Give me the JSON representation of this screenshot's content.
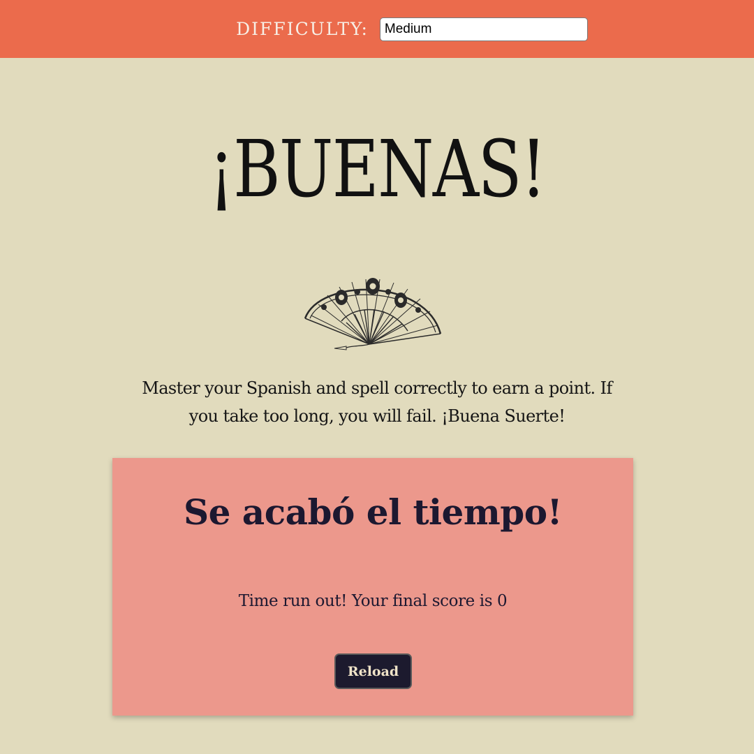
{
  "settings": {
    "difficulty_label": "DIFFICULTY:",
    "difficulty_value": "Medium"
  },
  "main": {
    "title": "¡BUENAS!",
    "illustration": "spanish-fan-icon",
    "intro": "Master your Spanish and spell correctly to earn a point. If you take too long, you will fail. ¡Buena Suerte!"
  },
  "result": {
    "title": "Se acabó el tiempo!",
    "message": "Time run out! Your final score is 0",
    "reload_label": "Reload"
  },
  "colors": {
    "header": "#eb6b4c",
    "background": "#e1dbbd",
    "card": "#ec988c",
    "button": "#1c1a2e"
  }
}
